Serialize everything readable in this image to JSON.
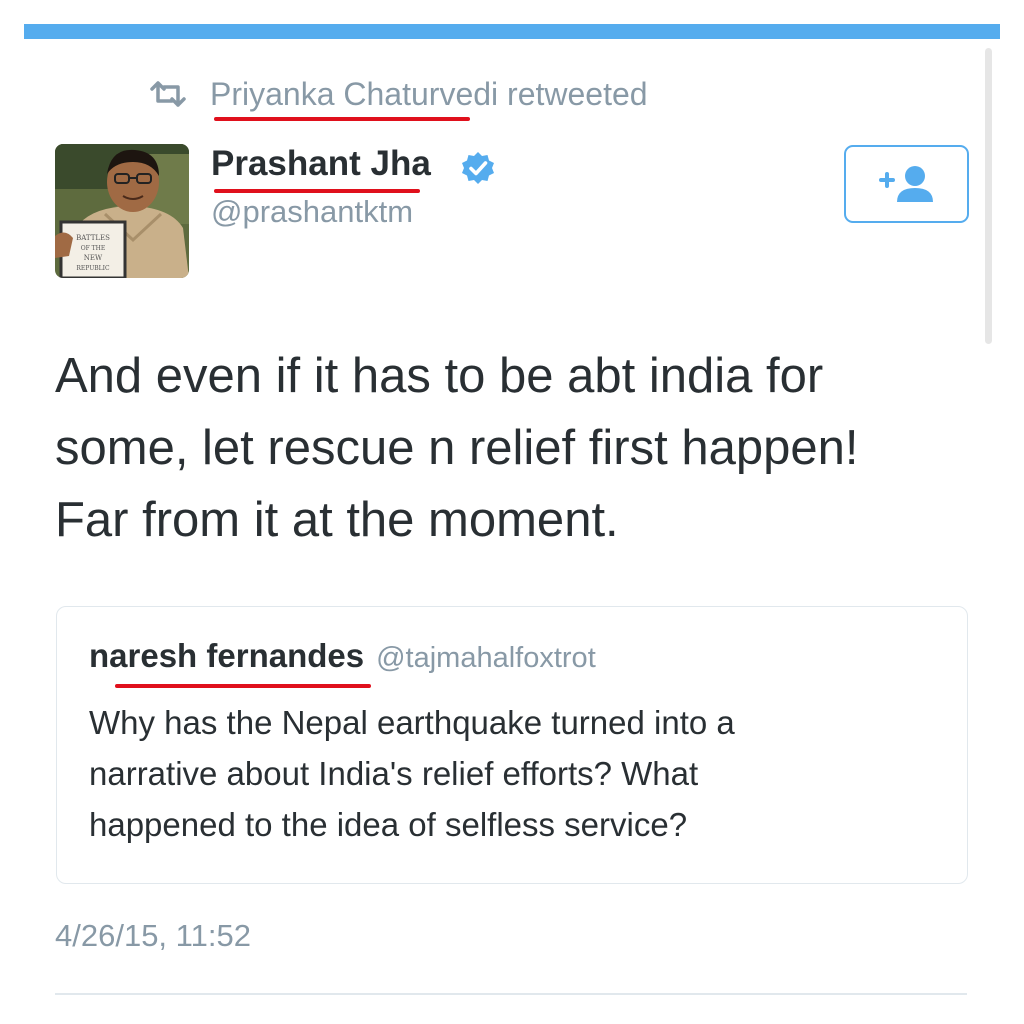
{
  "retweet": {
    "icon": "retweet-icon",
    "text": "Priyanka Chaturvedi retweeted"
  },
  "author": {
    "name": "Prashant Jha",
    "handle": "@prashantktm",
    "verified_icon": "verified-badge-icon",
    "avatar_book_text": [
      "BATTLES",
      "OF THE",
      "NEW",
      "REPUBLIC"
    ]
  },
  "follow_button": {
    "icon": "add-user-icon"
  },
  "tweet": {
    "lines": [
      "And even if it has to be abt india for",
      "some, let rescue n relief first happen!",
      "Far from it at the moment."
    ]
  },
  "quoted_tweet": {
    "name": "naresh fernandes",
    "handle": "@tajmahalfoxtrot",
    "lines": [
      "Why has the Nepal earthquake turned into a",
      "narrative about India's relief efforts? What",
      "happened to the idea of selfless service?"
    ]
  },
  "timestamp": "4/26/15, 11:52",
  "colors": {
    "accent": "#55acee",
    "highlight_underline": "#e0101c",
    "text_primary": "#292f33",
    "text_secondary": "#8899a6",
    "border": "#e1e8ed"
  }
}
